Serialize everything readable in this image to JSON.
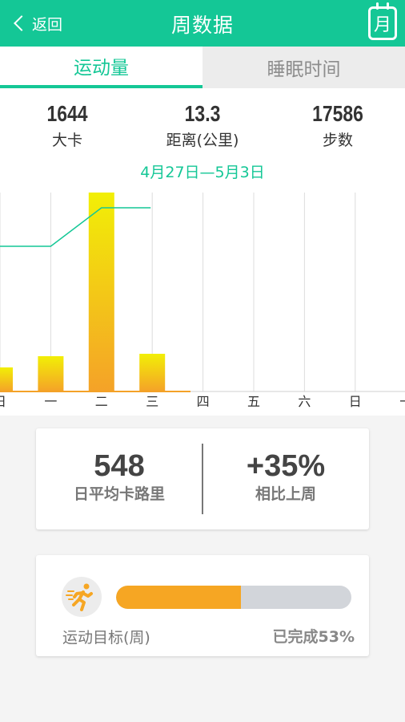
{
  "header": {
    "back_label": "返回",
    "title": "周数据",
    "calendar_icon_char": "月"
  },
  "tabs": [
    {
      "label": "运动量",
      "active": true
    },
    {
      "label": "睡眠时间",
      "active": false
    }
  ],
  "stats": [
    {
      "value": "1644",
      "label": "大卡"
    },
    {
      "value": "13.3",
      "label": "距离(公里)"
    },
    {
      "value": "17586",
      "label": "步数"
    }
  ],
  "date_range": "4月27日—5月3日",
  "chart_data": {
    "type": "bar",
    "categories": [
      "日",
      "一",
      "二",
      "三",
      "四",
      "五",
      "六",
      "日",
      "一"
    ],
    "series": [
      {
        "values": [
          30,
          44,
          248,
          47,
          null,
          null,
          null,
          null,
          null
        ],
        "color_top": "#f2ef06",
        "color_bottom": "#f4a228"
      },
      {
        "type": "line",
        "values": [
          181,
          181,
          229,
          229,
          null,
          null,
          null,
          null,
          null
        ],
        "color": "#14c796"
      }
    ],
    "ylim": [
      0,
      248
    ],
    "grid": true
  },
  "summary": {
    "daily_avg_value": "548",
    "daily_avg_label": "日平均卡路里",
    "compare_value": "+35%",
    "compare_label": "相比上周"
  },
  "goal": {
    "label": "运动目标(周)",
    "status": "已完成53%",
    "progress": 0.53,
    "icon": "runner-icon"
  },
  "colors": {
    "accent": "#14c796",
    "progress": "#f6a623",
    "progress_track": "#d2d5da"
  }
}
